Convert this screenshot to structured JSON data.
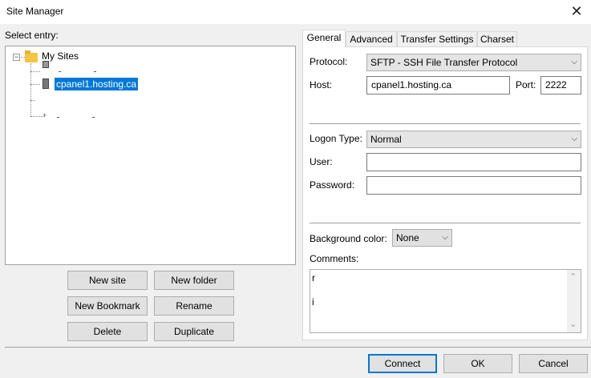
{
  "window": {
    "title": "Site Manager",
    "close": "✕"
  },
  "left": {
    "select_entry_label": "Select entry:",
    "tree": {
      "root": {
        "label": "My Sites",
        "expander": "−"
      },
      "selected_site": "cpanel1.hosting.ca",
      "child_expander": "+"
    },
    "buttons": {
      "new_site": "New site",
      "new_folder": "New folder",
      "new_bookmark": "New Bookmark",
      "rename": "Rename",
      "delete": "Delete",
      "duplicate": "Duplicate"
    }
  },
  "tabs": [
    {
      "label": "General",
      "active": true
    },
    {
      "label": "Advanced",
      "active": false
    },
    {
      "label": "Transfer Settings",
      "active": false
    },
    {
      "label": "Charset",
      "active": false
    }
  ],
  "general": {
    "protocol_label": "Protocol:",
    "protocol_value": "SFTP - SSH File Transfer Protocol",
    "host_label": "Host:",
    "host_value": "cpanel1.hosting.ca",
    "port_label": "Port:",
    "port_value": "2222",
    "logon_type_label": "Logon Type:",
    "logon_type_value": "Normal",
    "user_label": "User:",
    "user_value": "",
    "password_label": "Password:",
    "password_value": "",
    "bg_color_label": "Background color:",
    "bg_color_value": "None",
    "comments_label": "Comments:",
    "comments_line1": "r",
    "comments_line2": "i"
  },
  "footer": {
    "connect": "Connect",
    "ok": "OK",
    "cancel": "Cancel"
  },
  "icons": {
    "chevron": "⌵",
    "scroll_up": "⌃",
    "scroll_down": "⌄"
  }
}
